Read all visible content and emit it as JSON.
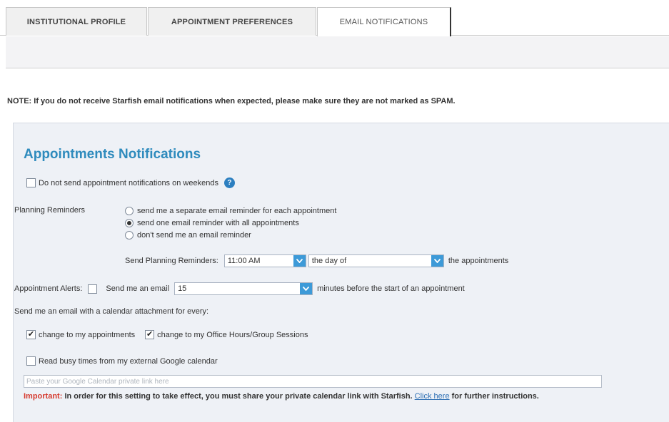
{
  "tabs": [
    {
      "label": "INSTITUTIONAL PROFILE"
    },
    {
      "label": "APPOINTMENT PREFERENCES"
    },
    {
      "label": "EMAIL NOTIFICATIONS"
    }
  ],
  "note": "NOTE: If you do not receive Starfish email notifications when expected, please make sure they are not marked as SPAM.",
  "section": {
    "heading": "Appointments Notifications",
    "weekends": {
      "label": "Do not send appointment notifications on weekends",
      "checked": false
    },
    "planning": {
      "label": "Planning Reminders",
      "options": [
        {
          "label": "send me a separate email reminder for each appointment",
          "selected": false
        },
        {
          "label": "send one email reminder with all appointments",
          "selected": true
        },
        {
          "label": "don't send me an email reminder",
          "selected": false
        }
      ],
      "send_label": "Send Planning Reminders:",
      "time_value": "11:00 AM",
      "day_value": "the day of",
      "suffix": "the appointments"
    },
    "alerts": {
      "label": "Appointment Alerts:",
      "checked": false,
      "send_label": "Send me an email",
      "minutes_value": "15",
      "suffix": "minutes before the start of an appointment"
    },
    "calendar": {
      "label": "Send me an email with a calendar attachment for every:",
      "change_appointments": {
        "label": "change to my appointments",
        "checked": true
      },
      "change_office_hours": {
        "label": "change to my Office Hours/Group Sessions",
        "checked": true
      }
    },
    "google": {
      "label": "Read busy times from my external Google calendar",
      "checked": false,
      "placeholder": "Paste your Google Calendar private link here"
    },
    "important": {
      "prefix": "Important:",
      "text": " In order for this setting to take effect, you must share your private calendar link with Starfish. ",
      "link": "Click here",
      "suffix": " for further instructions."
    }
  },
  "colors": {
    "accent": "#2e8bbd",
    "dropdown_arrow": "#3d9ad8",
    "important": "#d63b2f",
    "link": "#2e6fb3"
  }
}
